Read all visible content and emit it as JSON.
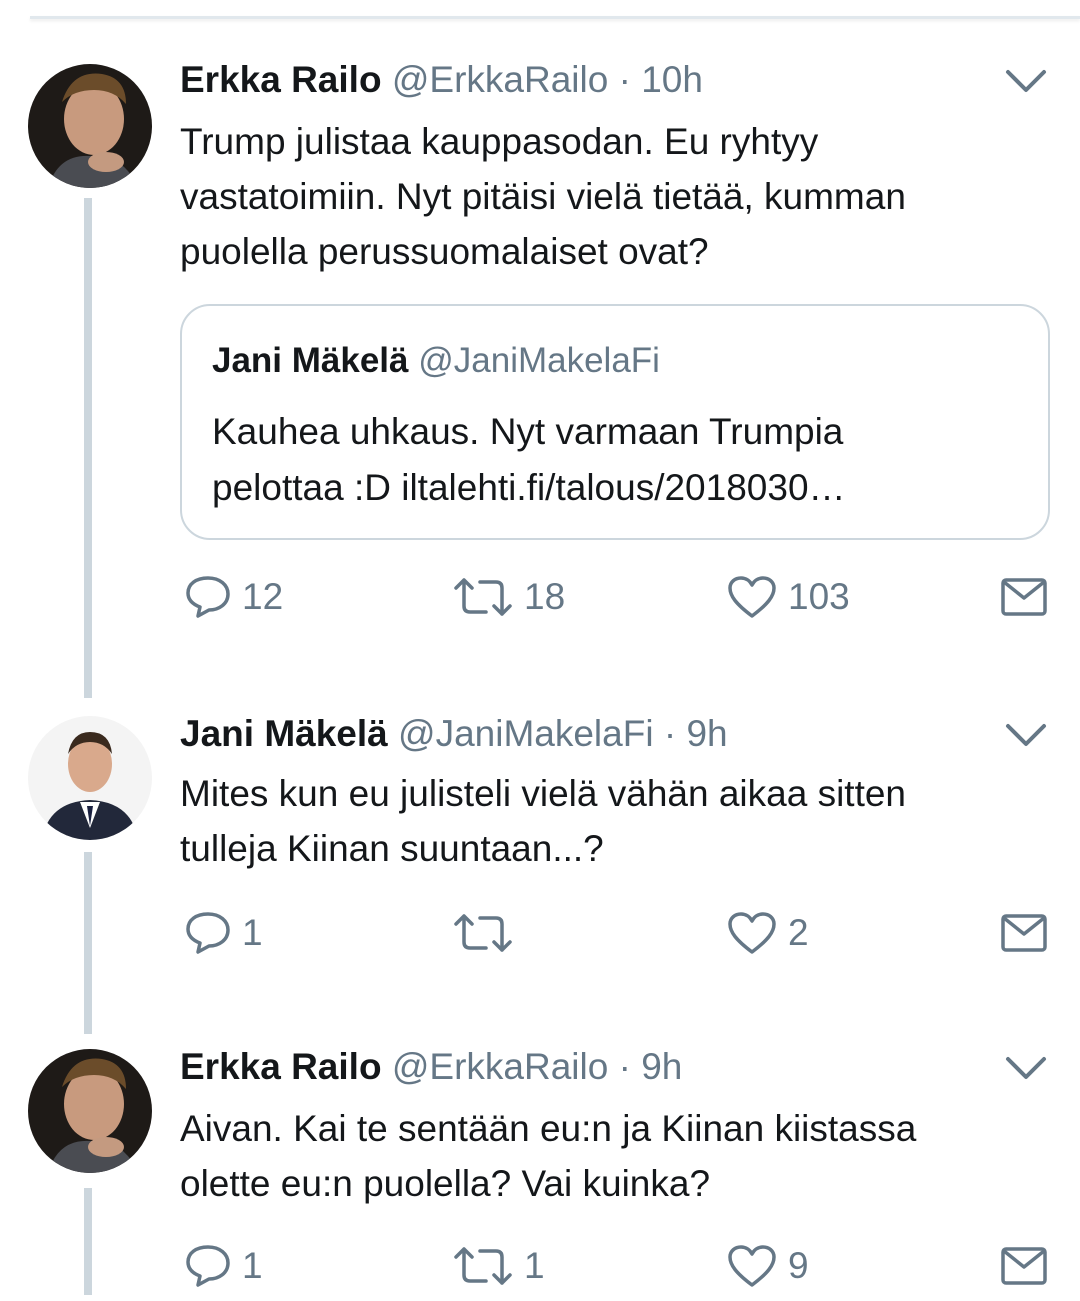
{
  "tweets": [
    {
      "name": "Erkka Railo",
      "handle": "@ErkkaRailo",
      "dot": "·",
      "time": "10h",
      "text_lines": [
        "Trump julistaa kauppasodan. Eu ryhtyy",
        "vastatoimiin. Nyt pitäisi vielä tietää, kumman",
        "puolella perussuomalaiset ovat?"
      ],
      "quote": {
        "name": "Jani Mäkelä",
        "handle": "@JaniMakelaFi",
        "text_lines": [
          "Kauhea uhkaus. Nyt varmaan Trumpia",
          "pelottaa :D iltalehti.fi/talous/2018030…"
        ]
      },
      "replies": "12",
      "retweets": "18",
      "likes": "103"
    },
    {
      "name": "Jani Mäkelä",
      "handle": "@JaniMakelaFi",
      "dot": "·",
      "time": "9h",
      "text_lines": [
        "Mites kun eu julisteli vielä vähän aikaa sitten",
        "tulleja Kiinan suuntaan...?"
      ],
      "replies": "1",
      "retweets": "",
      "likes": "2"
    },
    {
      "name": "Erkka Railo",
      "handle": "@ErkkaRailo",
      "dot": "·",
      "time": "9h",
      "text_lines": [
        "Aivan. Kai te sentään eu:n ja Kiinan kiistassa",
        "olette eu:n puolella? Vai kuinka?"
      ],
      "replies": "1",
      "retweets": "1",
      "likes": "9"
    }
  ],
  "icons": {
    "reply": "reply-icon",
    "retweet": "retweet-icon",
    "like": "heart-icon",
    "dm": "envelope-icon",
    "menu": "chevron-down-icon"
  },
  "colors": {
    "text": "#14171a",
    "secondary": "#657786",
    "thread_line": "#ccd6dd",
    "border": "#ccd6dd"
  }
}
